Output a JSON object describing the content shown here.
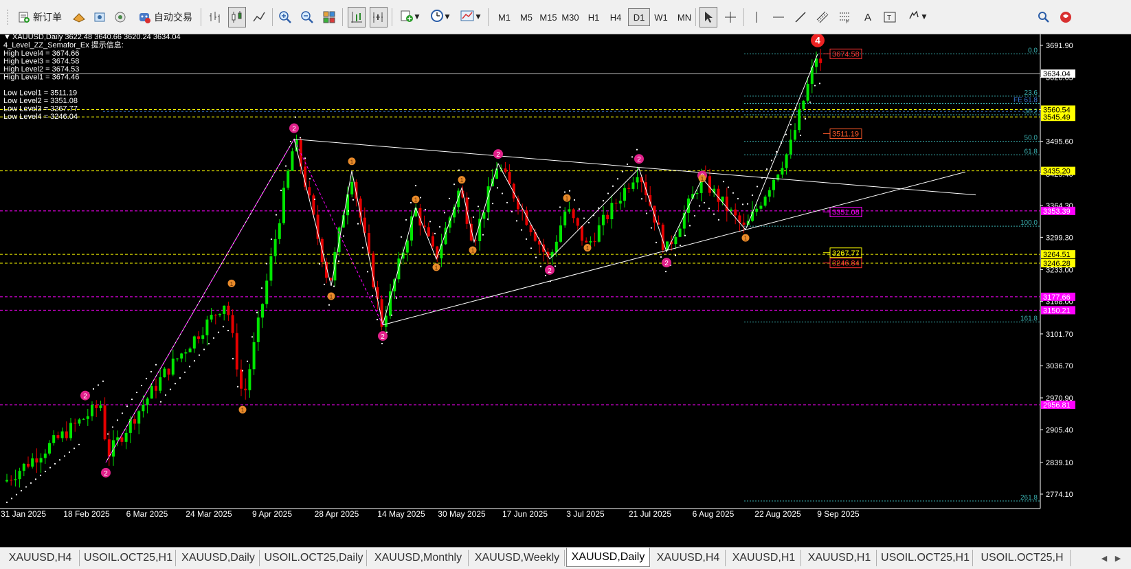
{
  "toolbar": {
    "new_order_label": "新订单",
    "auto_trade_label": "自动交易",
    "timeframes": [
      "M1",
      "M5",
      "M15",
      "M30",
      "H1",
      "H4",
      "D1",
      "W1",
      "MN"
    ],
    "active_timeframe": "D1",
    "text_tool_label": "A"
  },
  "chart": {
    "symbol_header": "XAUUSD,Daily  3622.48 3640.66 3620.24 3634.04",
    "indicator_title": "4_Level_ZZ_Semafor_Ex 提示信息:",
    "info_lines": [
      "High Level4 = 3674.66",
      "High Level3 = 3674.58",
      "High Level2 = 3674.53",
      "High Level1 = 3674.46",
      "",
      "Low Level1 = 3511.19",
      "Low Level2 = 3351.08",
      "Low Level3 = 3267.77",
      "Low Level4 = 3246.04"
    ],
    "price_scale": [
      "3691.90",
      "3626.65",
      "3560.54",
      "3495.60",
      "3429.40",
      "3364.30",
      "3299.30",
      "3233.00",
      "3168.00",
      "3101.70",
      "3036.70",
      "2970.90",
      "2905.40",
      "2839.10",
      "2774.10"
    ],
    "date_labels": [
      "31 Jan 2025",
      "18 Feb 2025",
      "6 Mar 2025",
      "24 Mar 2025",
      "9 Apr 2025",
      "28 Apr 2025",
      "14 May 2025",
      "30 May 2025",
      "17 Jun 2025",
      "3 Jul 2025",
      "21 Jul 2025",
      "6 Aug 2025",
      "22 Aug 2025",
      "9 Sep 2025"
    ],
    "current_price": "3634.04",
    "price_tags": [
      {
        "text": "3560.54",
        "bg": "#ffff00",
        "fg": "#000000"
      },
      {
        "text": "3545.49",
        "bg": "#ffff00",
        "fg": "#000000"
      },
      {
        "text": "3435.20",
        "bg": "#ffff00",
        "fg": "#000000"
      },
      {
        "text": "3353.39",
        "bg": "#ff00ff",
        "fg": "#ffffff"
      },
      {
        "text": "3264.51",
        "bg": "#ffff00",
        "fg": "#000000"
      },
      {
        "text": "3246.28",
        "bg": "#ffff00",
        "fg": "#000000"
      },
      {
        "text": "3177.66",
        "bg": "#ff00ff",
        "fg": "#ffffff"
      },
      {
        "text": "3150.21",
        "bg": "#ff00ff",
        "fg": "#ffffff"
      },
      {
        "text": "2956.81",
        "bg": "#ff00ff",
        "fg": "#ffffff"
      }
    ],
    "level_boxes": [
      {
        "text": "3674.58",
        "color": "#ff3333"
      },
      {
        "text": "3511.19",
        "color": "#ff5a2a"
      },
      {
        "text": "3351.08",
        "color": "#ff00ff"
      },
      {
        "text": "3267.77",
        "color": "#ffff00"
      },
      {
        "text": "3246.84",
        "color": "#ff3333"
      }
    ],
    "fib_labels": [
      "0.0",
      "23.6",
      "FE 61.8",
      "38.2",
      "50.0",
      "61.8",
      "100.0",
      "161.8",
      "261.8"
    ],
    "semafor_markers": {
      "level2_big": [
        "2",
        "2",
        "2",
        "2",
        "2",
        "2",
        "2",
        "2",
        "2"
      ],
      "level1_small": [
        "1",
        "1",
        "1",
        "1",
        "1",
        "1",
        "1",
        "1",
        "1",
        "1",
        "1",
        "1",
        "1",
        "1"
      ],
      "level4": "4"
    },
    "colors": {
      "bull": "#00e600",
      "bear": "#e60000",
      "fib": "#3ab0b0",
      "ma_dots": "#ffffff"
    }
  },
  "tabs": {
    "items": [
      "XAUUSD,H4",
      "USOIL.OCT25,H1",
      "XAUUSD,Daily",
      "USOIL.OCT25,Daily",
      "XAUUSD,Monthly",
      "XAUUSD,Weekly",
      "XAUUSD,Daily",
      "XAUUSD,H4",
      "XAUUSD,H1",
      "XAUUSD,H1",
      "USOIL.OCT25,H1",
      "USOIL.OCT25,H"
    ],
    "active_index": 6
  }
}
